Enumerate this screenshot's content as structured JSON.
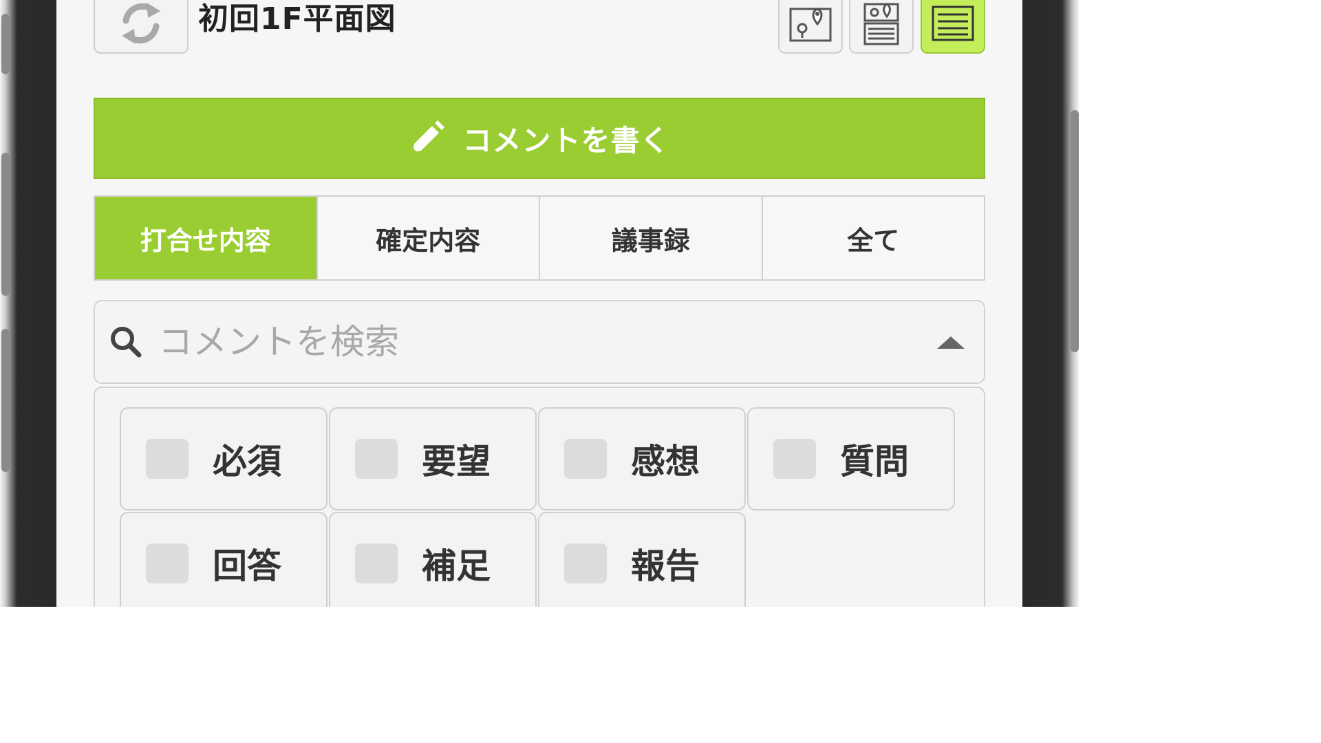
{
  "header": {
    "title": "初回1F平面図",
    "sync_icon": "sync-icon",
    "view_buttons": [
      {
        "icon": "map-pin-icon",
        "active": false
      },
      {
        "icon": "map-list-icon",
        "active": false
      },
      {
        "icon": "list-icon",
        "active": true
      }
    ]
  },
  "write_comment": {
    "label": "コメントを書く",
    "icon": "pencil-icon"
  },
  "tabs": [
    {
      "label": "打合せ内容",
      "active": true
    },
    {
      "label": "確定内容",
      "active": false
    },
    {
      "label": "議事録",
      "active": false
    },
    {
      "label": "全て",
      "active": false
    }
  ],
  "search": {
    "placeholder": "コメントを検索",
    "value": ""
  },
  "filters": [
    {
      "label": "必須",
      "checked": false
    },
    {
      "label": "要望",
      "checked": false
    },
    {
      "label": "感想",
      "checked": false
    },
    {
      "label": "質問",
      "checked": false
    },
    {
      "label": "回答",
      "checked": false
    },
    {
      "label": "補足",
      "checked": false
    },
    {
      "label": "報告",
      "checked": false
    }
  ],
  "colors": {
    "accent": "#9acd32",
    "active_view": "#c3ee5a"
  }
}
